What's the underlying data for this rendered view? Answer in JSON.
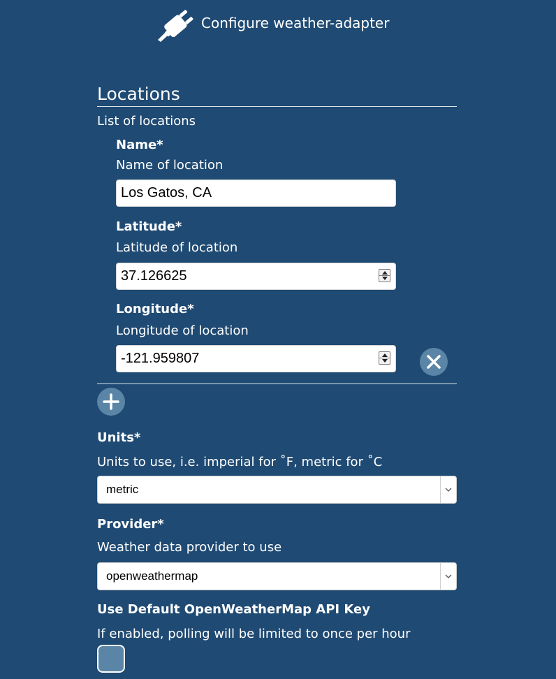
{
  "header": {
    "title": "Configure weather-adapter",
    "icon": "plug-icon"
  },
  "locations": {
    "title": "Locations",
    "description": "List of locations",
    "item": {
      "name": {
        "label": "Name*",
        "description": "Name of location",
        "value": "Los Gatos, CA"
      },
      "latitude": {
        "label": "Latitude*",
        "description": "Latitude of location",
        "value": "37.126625"
      },
      "longitude": {
        "label": "Longitude*",
        "description": "Longitude of location",
        "value": "-121.959807"
      },
      "remove_icon": "close-icon"
    },
    "add_icon": "plus-icon"
  },
  "units": {
    "label": "Units*",
    "description": "Units to use, i.e. imperial for ˚F, metric for ˚C",
    "selected": "metric"
  },
  "provider": {
    "label": "Provider*",
    "description": "Weather data provider to use",
    "selected": "openweathermap"
  },
  "default_key": {
    "label": "Use Default OpenWeatherMap API Key",
    "description": "If enabled, polling will be limited to once per hour",
    "checked": false
  },
  "colors": {
    "background": "#1f4a73",
    "button": "#5b85a6",
    "text": "#ffffff"
  }
}
